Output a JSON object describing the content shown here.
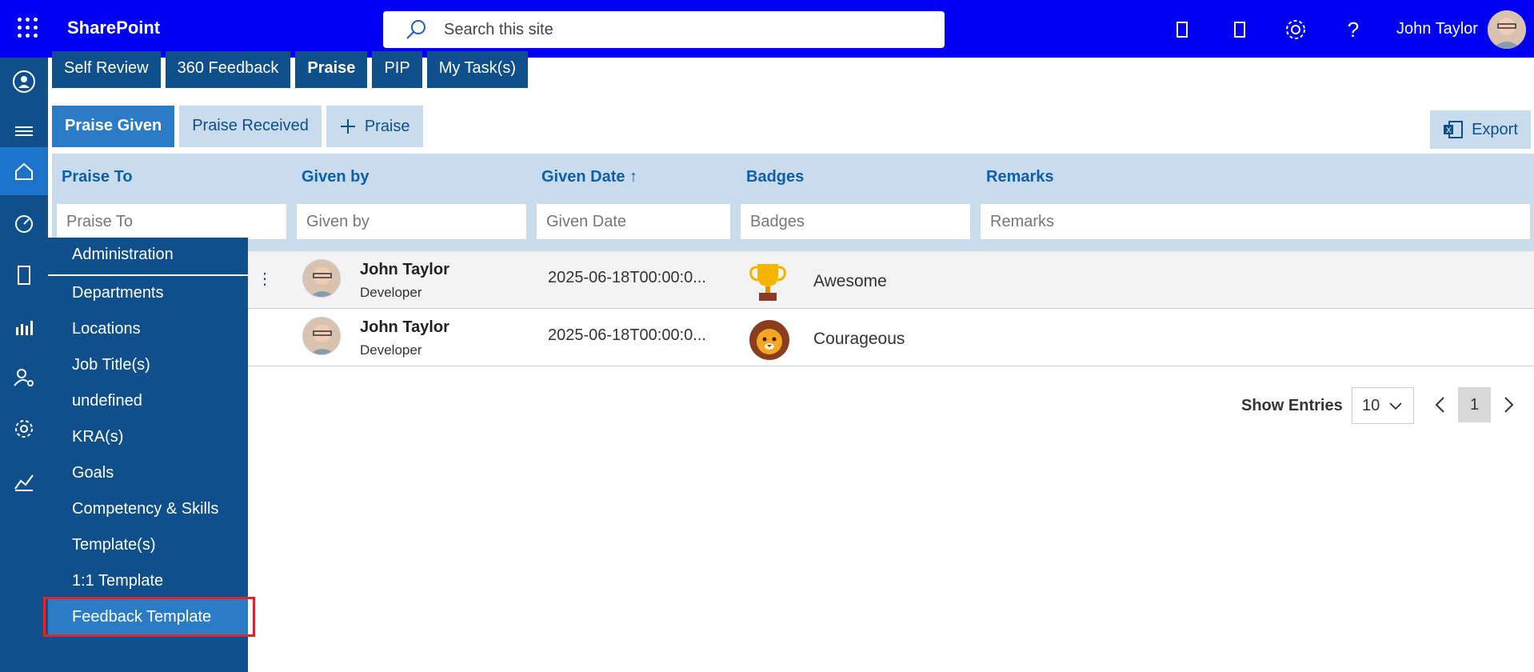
{
  "header": {
    "brand": "SharePoint",
    "search_placeholder": "Search this site",
    "user_name": "John Taylor"
  },
  "tabs": [
    "Self Review",
    "360 Feedback",
    "Praise",
    "PIP",
    "My Task(s)"
  ],
  "subtabs": {
    "given": "Praise Given",
    "received": "Praise Received",
    "add": "Praise",
    "export": "Export"
  },
  "columns": {
    "praise_to": "Praise To",
    "given_by": "Given by",
    "given_date": "Given Date ↑",
    "badges": "Badges",
    "remarks": "Remarks"
  },
  "filters": {
    "praise_to": "Praise To",
    "given_by": "Given by",
    "given_date": "Given Date",
    "badges": "Badges",
    "remarks": "Remarks"
  },
  "rows": [
    {
      "given_by_name": "John Taylor",
      "given_by_role": "Developer",
      "given_date": "2025-06-18T00:00:0...",
      "badge": "Awesome",
      "badge_icon": "trophy-icon"
    },
    {
      "given_by_name": "John Taylor",
      "given_by_role": "Developer",
      "given_date": "2025-06-18T00:00:0...",
      "badge": "Courageous",
      "badge_icon": "lion-icon"
    }
  ],
  "pager": {
    "label": "Show Entries",
    "page_size": "10",
    "current_page": "1"
  },
  "flyout": {
    "header": "Administration",
    "items": [
      "Departments",
      "Locations",
      "Job Title(s)",
      "undefined",
      "KRA(s)",
      "Goals",
      "Competency & Skills",
      "Template(s)",
      "1:1 Template",
      "Feedback Template"
    ],
    "highlighted": "Feedback Template"
  },
  "colors": {
    "topbar": "#0000f5",
    "navy": "#0f4f8c",
    "accent": "#2a7cc7",
    "light": "#c8dcee",
    "outline": "#e0262c"
  }
}
